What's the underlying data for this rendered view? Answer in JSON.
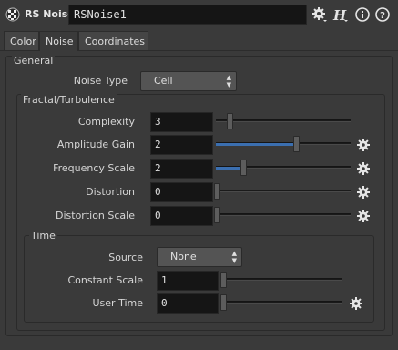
{
  "header": {
    "node_type": "RS Noise",
    "node_name": "RSNoise1",
    "icons": [
      "checker-icon",
      "gear-icon",
      "houdini-help-icon",
      "info-icon",
      "help-icon"
    ]
  },
  "tabs": [
    {
      "label": "Color",
      "active": false
    },
    {
      "label": "Noise",
      "active": true
    },
    {
      "label": "Coordinates",
      "active": false
    }
  ],
  "general": {
    "title": "General",
    "noise_type": {
      "label": "Noise Type",
      "value": "Cell"
    }
  },
  "fractal": {
    "title": "Fractal/Turbulence",
    "complexity": {
      "label": "Complexity",
      "value": "3",
      "level": 0.08
    },
    "amplitude_gain": {
      "label": "Amplitude Gain",
      "value": "2",
      "level": 0.6
    },
    "frequency_scale": {
      "label": "Frequency Scale",
      "value": "2",
      "level": 0.2
    },
    "distortion": {
      "label": "Distortion",
      "value": "0",
      "level": 0
    },
    "distortion_scale": {
      "label": "Distortion Scale",
      "value": "0",
      "level": 0
    }
  },
  "time": {
    "title": "Time",
    "source": {
      "label": "Source",
      "value": "None"
    },
    "constant_scale": {
      "label": "Constant Scale",
      "value": "1",
      "level": 0
    },
    "user_time": {
      "label": "User Time",
      "value": "0",
      "level": 0
    }
  },
  "colors": {
    "background": "#3a3a3a",
    "field": "#151515",
    "accent_fill": "#3b6fb0"
  }
}
